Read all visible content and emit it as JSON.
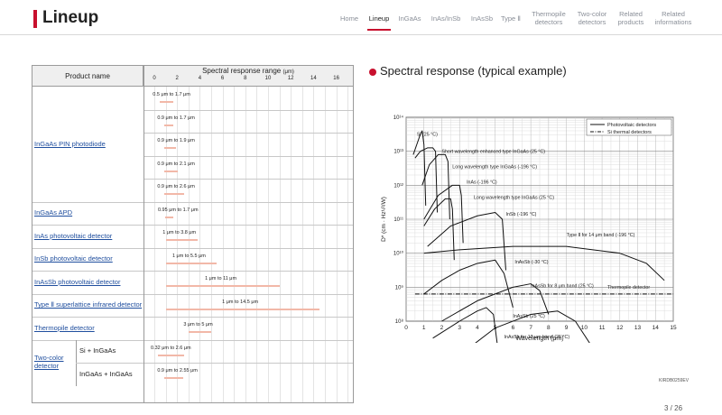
{
  "header": {
    "title": "Lineup",
    "nav": [
      {
        "label": "Home"
      },
      {
        "label": "Lineup"
      },
      {
        "label": "InGaAs"
      },
      {
        "label": "InAs/InSb"
      },
      {
        "label": "InAsSb"
      },
      {
        "label": "Type Ⅱ"
      },
      {
        "label": "Thermopile\ndetectors"
      },
      {
        "label": "Two-color\ndetectors"
      },
      {
        "label": "Related\nproducts"
      },
      {
        "label": "Related\ninformations"
      }
    ],
    "active_index": 1,
    "accent_color": "#c8102e"
  },
  "table": {
    "col_product": "Product name",
    "col_range": "Spectral response range",
    "col_range_unit": "(μm)",
    "ticks": [
      "0",
      "2",
      "4",
      "6",
      "8",
      "10",
      "12",
      "14",
      "16"
    ],
    "products": [
      {
        "name": "InGaAs PIN photodiode",
        "ranges": [
          {
            "label": "0.5 μm to 1.7 μm",
            "min": 0.5,
            "max": 1.7
          },
          {
            "label": "0.9 μm to 1.7 μm",
            "min": 0.9,
            "max": 1.7
          },
          {
            "label": "0.9 μm to 1.9 μm",
            "min": 0.9,
            "max": 1.9
          },
          {
            "label": "0.9 μm to 2.1 μm",
            "min": 0.9,
            "max": 2.1
          },
          {
            "label": "0.9 μm to 2.6 μm",
            "min": 0.9,
            "max": 2.6
          }
        ]
      },
      {
        "name": "InGaAs APD",
        "ranges": [
          {
            "label": "0.95 μm to 1.7 μm",
            "min": 0.95,
            "max": 1.7
          }
        ]
      },
      {
        "name": "InAs photovoltaic detector",
        "ranges": [
          {
            "label": "1 μm to 3.8 μm",
            "min": 1,
            "max": 3.8
          }
        ]
      },
      {
        "name": "InSb photovoltaic detector",
        "ranges": [
          {
            "label": "1 μm to 5.5 μm",
            "min": 1,
            "max": 5.5
          }
        ]
      },
      {
        "name": "InAsSb photovoltaic detector",
        "ranges": [
          {
            "label": "1 μm to 11 μm",
            "min": 1,
            "max": 11
          }
        ]
      },
      {
        "name": "Type Ⅱ superlattice infrared detector",
        "ranges": [
          {
            "label": "1 μm to 14.5 μm",
            "min": 1,
            "max": 14.5
          }
        ]
      },
      {
        "name": "Thermopile detector",
        "ranges": [
          {
            "label": "3 μm to 5 μm",
            "min": 3,
            "max": 5
          }
        ]
      },
      {
        "name": "Two-color detector",
        "ranges": [
          {
            "sub": "Si + InGaAs",
            "label": "0.32 μm to 2.6 μm",
            "min": 0.32,
            "max": 2.6
          },
          {
            "sub": "InGaAs + InGaAs",
            "label": "0.9 μm to 2.55 μm",
            "min": 0.9,
            "max": 2.55
          }
        ]
      }
    ],
    "bar_color": "#f2b8a8"
  },
  "section_title": "Spectral response (typical example)",
  "chart_data": {
    "type": "line",
    "xlabel": "Wavelength (μm)",
    "ylabel": "D* (cm · Hz¹/²/W)",
    "xlim": [
      0,
      15
    ],
    "ylim_exponent": [
      8,
      14
    ],
    "log_y": true,
    "x_ticks": [
      "0",
      "1",
      "2",
      "3",
      "4",
      "5",
      "6",
      "7",
      "8",
      "9",
      "10",
      "11",
      "12",
      "13",
      "14",
      "15"
    ],
    "y_ticks": [
      "10⁸",
      "10⁹",
      "10¹⁰",
      "10¹¹",
      "10¹²",
      "10¹³",
      "10¹⁴"
    ],
    "legend": [
      {
        "name": "Photovoltaic detectors",
        "style": "solid"
      },
      {
        "name": "Si thermal detectors",
        "style": "dashdot"
      }
    ],
    "annotations": [
      "Si (25 °C)",
      "Short wavelength enhanced type InGaAs (25 °C)",
      "Long wavelength type InGaAs (-196 °C)",
      "InAs (-196 °C)",
      "Long wavelength type InGaAs (25 °C)",
      "InSb (-196 °C)",
      "Type Ⅱ for 14 μm band (-196 °C)",
      "InAsSb (-30 °C)",
      "InAsSb for 8 μm band (25 °C)",
      "Thermopile detector",
      "InAsSb (25 °C)",
      "InAsSb for 10 μm band (25 °C)"
    ],
    "series": [
      {
        "name": "Si (25 °C)",
        "x": [
          0.4,
          0.6,
          0.8,
          0.9,
          1.0,
          1.1
        ],
        "y": [
          12.9,
          13.2,
          13.5,
          13.6,
          13.2,
          11.4
        ]
      },
      {
        "name": "Short wavelength enhanced type InGaAs (25 °C)",
        "x": [
          0.5,
          0.8,
          1.2,
          1.5,
          1.65,
          1.75
        ],
        "y": [
          12.8,
          13.0,
          13.1,
          13.1,
          13.0,
          11.2
        ]
      },
      {
        "name": "Long wavelength type InGaAs (-196 °C)",
        "x": [
          0.9,
          1.3,
          1.8,
          2.2,
          2.35,
          2.45
        ],
        "y": [
          12.0,
          12.6,
          12.9,
          12.9,
          12.7,
          11.0
        ]
      },
      {
        "name": "InAs (-196 °C)",
        "x": [
          1.0,
          1.8,
          2.6,
          3.0,
          3.1,
          3.2
        ],
        "y": [
          11.0,
          11.7,
          12.0,
          12.0,
          11.7,
          10.3
        ]
      },
      {
        "name": "Long wavelength type InGaAs (25 °C)",
        "x": [
          1.0,
          1.6,
          2.2,
          2.5,
          2.6,
          2.7
        ],
        "y": [
          10.8,
          11.3,
          11.6,
          11.6,
          11.3,
          9.8
        ]
      },
      {
        "name": "InSb (-196 °C)",
        "x": [
          1.2,
          2.5,
          4.0,
          5.0,
          5.4,
          5.6
        ],
        "y": [
          10.2,
          10.8,
          11.1,
          11.2,
          11.0,
          9.5
        ]
      },
      {
        "name": "Type Ⅱ for 14 μm band (-196 °C)",
        "x": [
          1.0,
          3.0,
          6.0,
          9.0,
          12.0,
          13.5,
          14.5
        ],
        "y": [
          10.0,
          10.1,
          10.2,
          10.2,
          10.0,
          9.7,
          9.2
        ]
      },
      {
        "name": "InAsSb (-30 °C)",
        "x": [
          1.0,
          2.0,
          3.0,
          4.0,
          5.0,
          5.5,
          6.0
        ],
        "y": [
          8.8,
          9.2,
          9.5,
          9.7,
          9.8,
          9.4,
          8.4
        ]
      },
      {
        "name": "InAsSb for 8 μm band (25 °C)",
        "x": [
          2.0,
          4.0,
          6.0,
          7.0,
          7.5,
          8.0
        ],
        "y": [
          8.0,
          8.6,
          9.0,
          9.1,
          8.9,
          8.2
        ]
      },
      {
        "name": "Thermopile detector",
        "x": [
          0.5,
          15.0
        ],
        "y": [
          8.8,
          8.8
        ]
      },
      {
        "name": "InAsSb (25 °C)",
        "x": [
          1.5,
          3.0,
          4.0,
          4.5,
          4.9,
          5.2
        ],
        "y": [
          7.5,
          8.0,
          8.3,
          8.4,
          8.2,
          7.0
        ]
      },
      {
        "name": "InAsSb for 10 μm band (25 °C)",
        "x": [
          3.0,
          5.0,
          7.0,
          8.5,
          9.5,
          10.5
        ],
        "y": [
          7.0,
          7.8,
          8.2,
          8.3,
          8.0,
          7.2
        ]
      }
    ]
  },
  "chart_code": "KIRDB0259EV",
  "page_number": "3 / 26"
}
